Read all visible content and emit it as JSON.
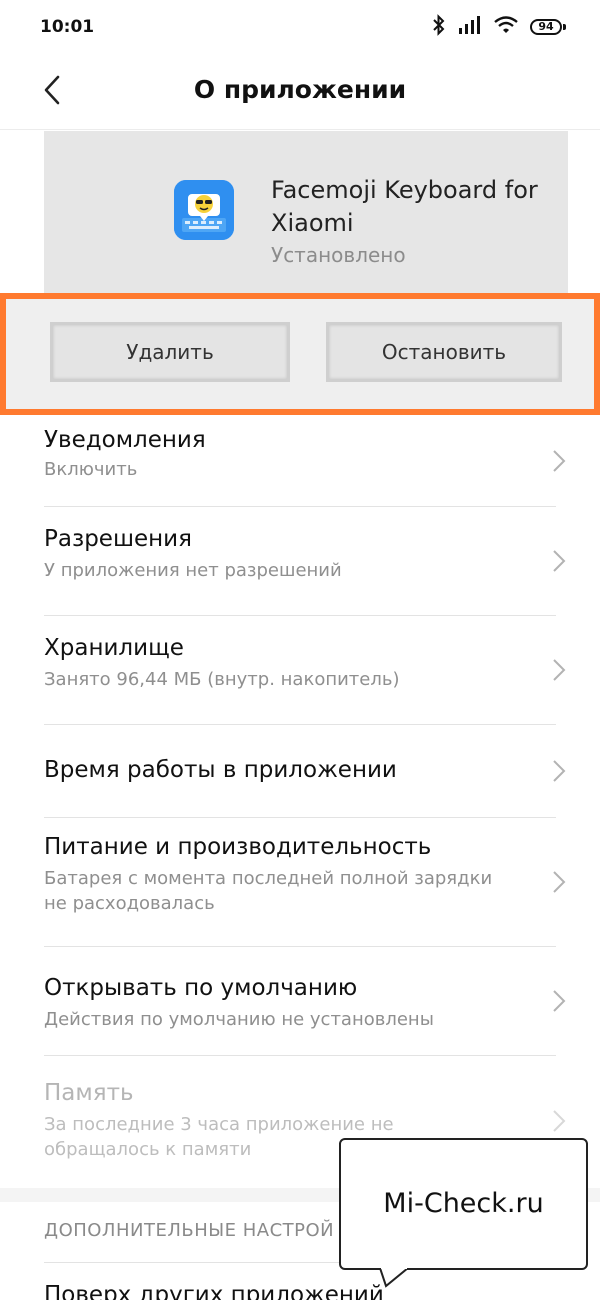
{
  "status_bar": {
    "time": "10:01",
    "battery": "94",
    "icons": [
      "bluetooth-icon",
      "signal-icon",
      "wifi-icon",
      "battery-icon"
    ]
  },
  "header": {
    "title": "О приложении",
    "back_icon": "chevron-left-icon"
  },
  "app": {
    "name": "Facemoji Keyboard for Xiaomi",
    "status": "Установлено",
    "icon": "facemoji-app-icon",
    "icon_color": "#2f8ff0"
  },
  "actions": {
    "uninstall": "Удалить",
    "stop": "Остановить",
    "highlight_color": "#ff7a2f"
  },
  "items": [
    {
      "title": "Уведомления",
      "subtitle": "Включить"
    },
    {
      "title": "Разрешения",
      "subtitle": "У приложения нет разрешений"
    },
    {
      "title": "Хранилище",
      "subtitle": "Занято 96,44 МБ (внутр. накопитель)"
    },
    {
      "title": "Время работы в приложении",
      "subtitle": ""
    },
    {
      "title": "Питание и производительность",
      "subtitle": "Батарея с момента последней полной зарядки не расходовалась"
    },
    {
      "title": "Открывать по умолчанию",
      "subtitle": "Действия по умолчанию не установлены"
    },
    {
      "title": "Память",
      "subtitle": "За последние 3 часа приложение не обращалось к памяти",
      "disabled": true
    }
  ],
  "section": {
    "header": "ДОПОЛНИТЕЛЬНЫЕ НАСТРОЙ",
    "next_item": "Поверх других приложений"
  },
  "watermark": {
    "text": "Mi-Check.ru"
  }
}
